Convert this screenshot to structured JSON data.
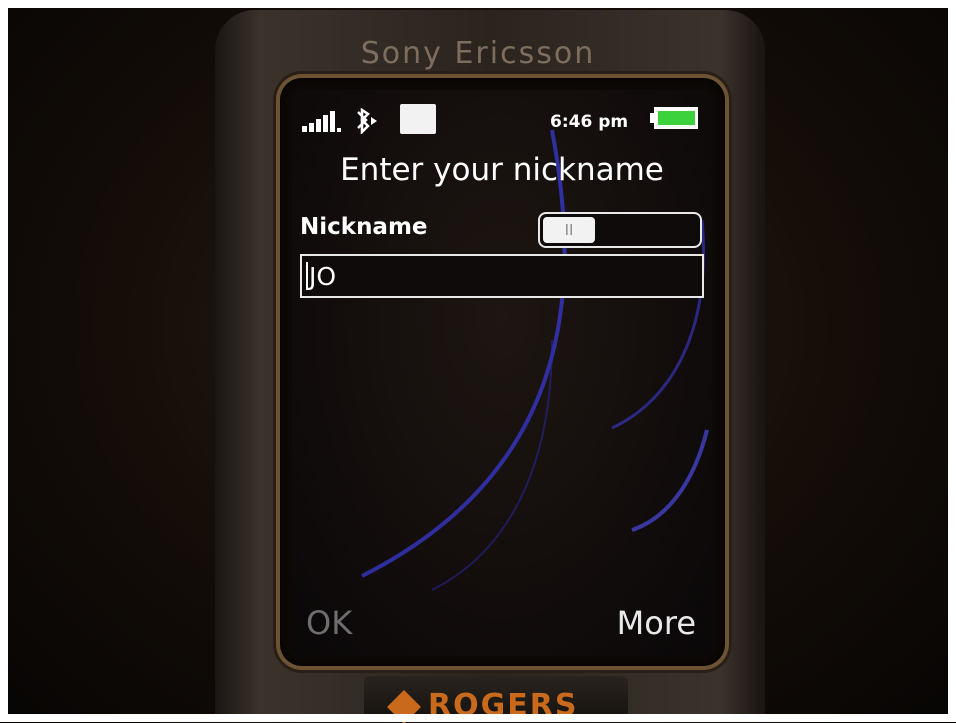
{
  "device": {
    "brand": "Sony Ericsson",
    "carrier": "ROGERS"
  },
  "status_bar": {
    "time": "6:46 pm",
    "icons": [
      "signal-strength-icon",
      "bluetooth-icon",
      "operator-icon",
      "battery-icon"
    ]
  },
  "screen": {
    "title": "Enter your nickname",
    "field_label": "Nickname",
    "input_mode_indicator": "II",
    "nickname_value": "JO"
  },
  "softkeys": {
    "left": "OK",
    "right": "More"
  },
  "colors": {
    "screen_background": "#120d0c",
    "wallpaper_arc": "#3a3ad0",
    "text": "#ffffff",
    "disabled_softkey": "#6e6e6e",
    "battery_fill": "#3cd23c",
    "carrier_orange": "#c9691c"
  }
}
